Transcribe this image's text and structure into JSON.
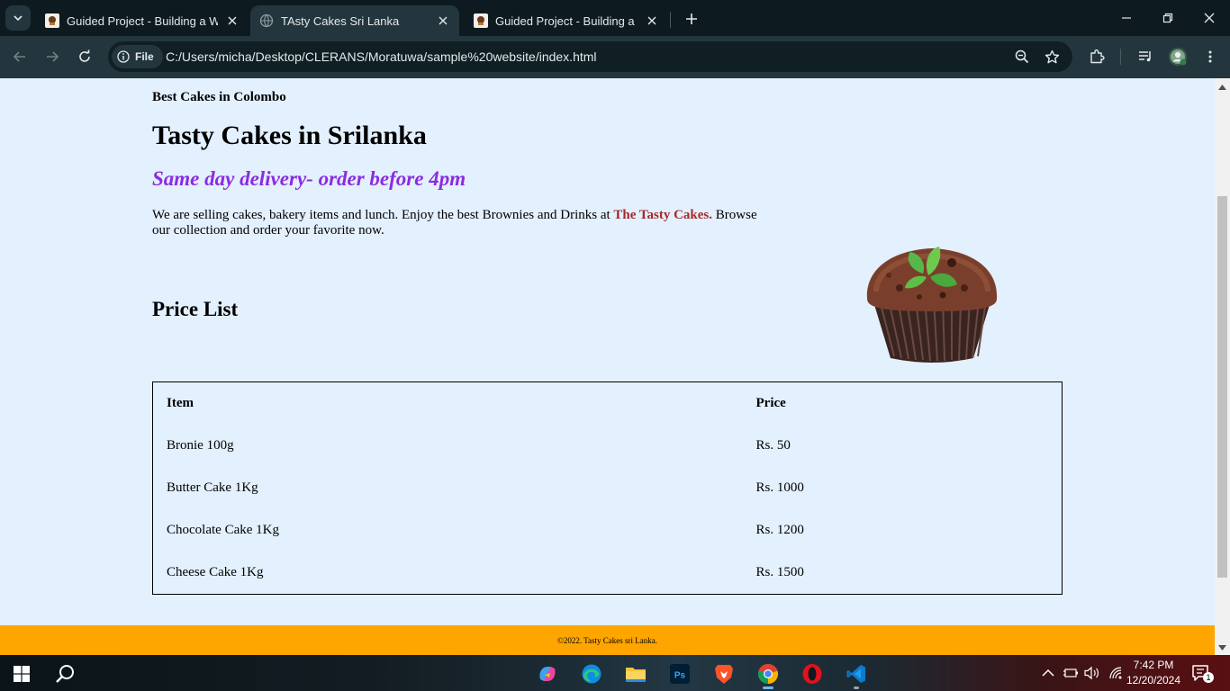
{
  "browser": {
    "tabs": [
      {
        "title": "Guided Project - Building a Web",
        "active": false
      },
      {
        "title": "TAsty Cakes Sri Lanka",
        "active": true
      },
      {
        "title": "Guided Project - Building a Web",
        "active": false
      }
    ],
    "site_chip": "File",
    "url": "C:/Users/micha/Desktop/CLERANS/Moratuwa/sample%20website/index.html"
  },
  "page": {
    "kicker": "Best Cakes in Colombo",
    "title": "Tasty Cakes in Srilanka",
    "tagline": "Same day delivery- order before 4pm",
    "intro_before": "We are selling cakes, bakery items and lunch. Enjoy the best Brownies and Drinks at ",
    "intro_brand": "The Tasty Cakes.",
    "intro_after": " Browse our collection and order your favorite now.",
    "price_heading": "Price List",
    "table": {
      "headers": [
        "Item",
        "Price"
      ],
      "rows": [
        [
          "Bronie 100g",
          "Rs. 50"
        ],
        [
          "Butter Cake 1Kg",
          "Rs. 1000"
        ],
        [
          "Chocolate Cake 1Kg",
          "Rs. 1200"
        ],
        [
          "Cheese Cake 1Kg",
          "Rs. 1500"
        ]
      ]
    },
    "footer": "©2022. Tasty Cakes sri Lanka."
  },
  "taskbar": {
    "time": "7:42 PM",
    "date": "12/20/2024",
    "notification_count": "1",
    "apps": [
      "windows-start",
      "search",
      "copilot",
      "edge",
      "file-explorer",
      "photoshop",
      "brave",
      "chrome",
      "opera",
      "vscode"
    ]
  },
  "colors": {
    "page_bg": "#e3f0fd",
    "tagline": "#8a2be2",
    "brand": "#a52a2a",
    "footer_bg": "#ffa500",
    "chrome_dark": "#0d1b21",
    "chrome_toolbar": "#24363d"
  }
}
